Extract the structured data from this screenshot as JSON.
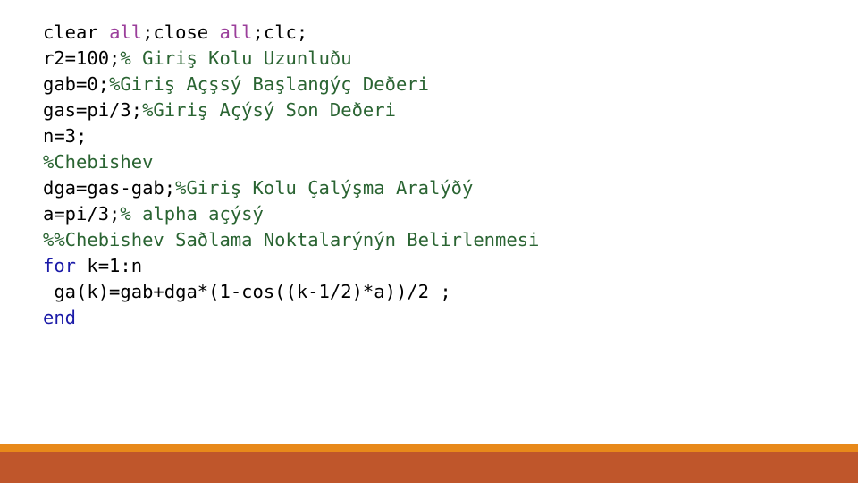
{
  "slide": {
    "background_color": "#ffffff",
    "language": "matlab"
  },
  "colors": {
    "plain": "#000000",
    "comment": "#2a6432",
    "string": "#9b3f9b",
    "keyword": "#1b1ba8",
    "stripe_top": "#e8891a",
    "stripe_bottom": "#bf562b"
  },
  "code": {
    "lines": [
      {
        "index": 1,
        "text": "clear all;close all;clc;",
        "tokens": [
          {
            "t": "clear ",
            "c": "plain"
          },
          {
            "t": "all",
            "c": "string"
          },
          {
            "t": ";close ",
            "c": "plain"
          },
          {
            "t": "all",
            "c": "string"
          },
          {
            "t": ";clc;",
            "c": "plain"
          }
        ]
      },
      {
        "index": 2,
        "text": "r2=100;% Giriş Kolu Uzunluðu",
        "tokens": [
          {
            "t": "r2=100;",
            "c": "plain"
          },
          {
            "t": "% Giriş Kolu Uzunluðu",
            "c": "comment"
          }
        ]
      },
      {
        "index": 3,
        "text": "gab=0;%Giriş Açşsý Başlangýç Deðeri",
        "tokens": [
          {
            "t": "gab=0;",
            "c": "plain"
          },
          {
            "t": "%Giriş Açşsý Başlangýç Deðeri",
            "c": "comment"
          }
        ]
      },
      {
        "index": 4,
        "text": "gas=pi/3;%Giriş Açýsý Son Deðeri",
        "tokens": [
          {
            "t": "gas=pi/3;",
            "c": "plain"
          },
          {
            "t": "%Giriş Açýsý Son Deðeri",
            "c": "comment"
          }
        ]
      },
      {
        "index": 5,
        "text": "n=3;",
        "tokens": [
          {
            "t": "n=3;",
            "c": "plain"
          }
        ]
      },
      {
        "index": 6,
        "text": "%Chebishev",
        "tokens": [
          {
            "t": "%Chebishev",
            "c": "comment"
          }
        ]
      },
      {
        "index": 7,
        "text": "dga=gas-gab;%Giriş Kolu Çalýşma Aralýðý",
        "tokens": [
          {
            "t": "dga=gas-gab;",
            "c": "plain"
          },
          {
            "t": "%Giriş Kolu Çalýşma Aralýðý",
            "c": "comment"
          }
        ]
      },
      {
        "index": 8,
        "text": "a=pi/3;% alpha açýsý",
        "tokens": [
          {
            "t": "a=pi/3;",
            "c": "plain"
          },
          {
            "t": "% alpha açýsý",
            "c": "comment"
          }
        ]
      },
      {
        "index": 9,
        "text": "%%Chebishev Saðlama Noktalarýnýn Belirlenmesi",
        "tokens": [
          {
            "t": "%%Chebishev Saðlama Noktalarýnýn Belirlenmesi",
            "c": "comment"
          }
        ]
      },
      {
        "index": 10,
        "text": "for k=1:n",
        "tokens": [
          {
            "t": "for",
            "c": "keyword"
          },
          {
            "t": " k=1:n",
            "c": "plain"
          }
        ]
      },
      {
        "index": 11,
        "text": " ga(k)=gab+dga*(1-cos((k-1/2)*a))/2 ;",
        "tokens": [
          {
            "t": " ga(k)=gab+dga*(1-cos((k-1/2)*a))/2 ;",
            "c": "plain"
          }
        ]
      },
      {
        "index": 12,
        "text": "end",
        "tokens": [
          {
            "t": "end",
            "c": "keyword"
          }
        ]
      }
    ]
  }
}
